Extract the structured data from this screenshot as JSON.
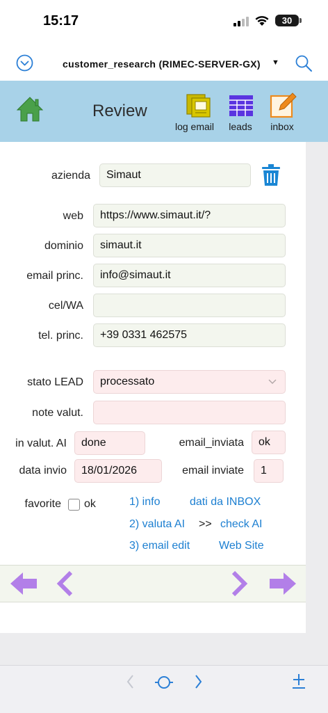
{
  "status": {
    "time": "15:17",
    "battery": "30"
  },
  "header": {
    "file_title": "customer_research (RIMEC-SERVER-GX)",
    "caret": "▼"
  },
  "toolbar": {
    "title": "Review",
    "log_email_label": "log email",
    "leads_label": "leads",
    "inbox_label": "inbox"
  },
  "form": {
    "azienda": {
      "label": "azienda",
      "value": "Simaut"
    },
    "web": {
      "label": "web",
      "value": "https://www.simaut.it/?"
    },
    "dominio": {
      "label": "dominio",
      "value": "simaut.it"
    },
    "email": {
      "label": "email princ.",
      "value": "info@simaut.it"
    },
    "cel": {
      "label": "cel/WA",
      "value": ""
    },
    "tel": {
      "label": "tel. princ.",
      "value": "+39 0331 462575"
    },
    "stato": {
      "label": "stato LEAD",
      "value": "processato"
    },
    "note": {
      "label": "note valut.",
      "value": ""
    },
    "in_valut": {
      "label": "in valut. AI",
      "value": "done"
    },
    "email_inviata": {
      "label": "email_inviata",
      "value": "ok"
    },
    "data_invio": {
      "label": "data invio",
      "value": "18/01/2026"
    },
    "email_inviate": {
      "label": "email inviate",
      "value": "1"
    },
    "favorite": {
      "label": "favorite",
      "checkbox_label": "ok"
    }
  },
  "links": {
    "info": "1) info",
    "dati_inbox": "dati da INBOX",
    "valuta": "2) valuta AI",
    "arrow": ">>",
    "check": "check AI",
    "email_edit": "3) email edit",
    "web_site": "Web Site"
  },
  "colors": {
    "toolbar": "#a8d2e8",
    "nav_arrows": "#b27fe8",
    "link": "#1c7fd1",
    "home": "#4aa04a"
  }
}
